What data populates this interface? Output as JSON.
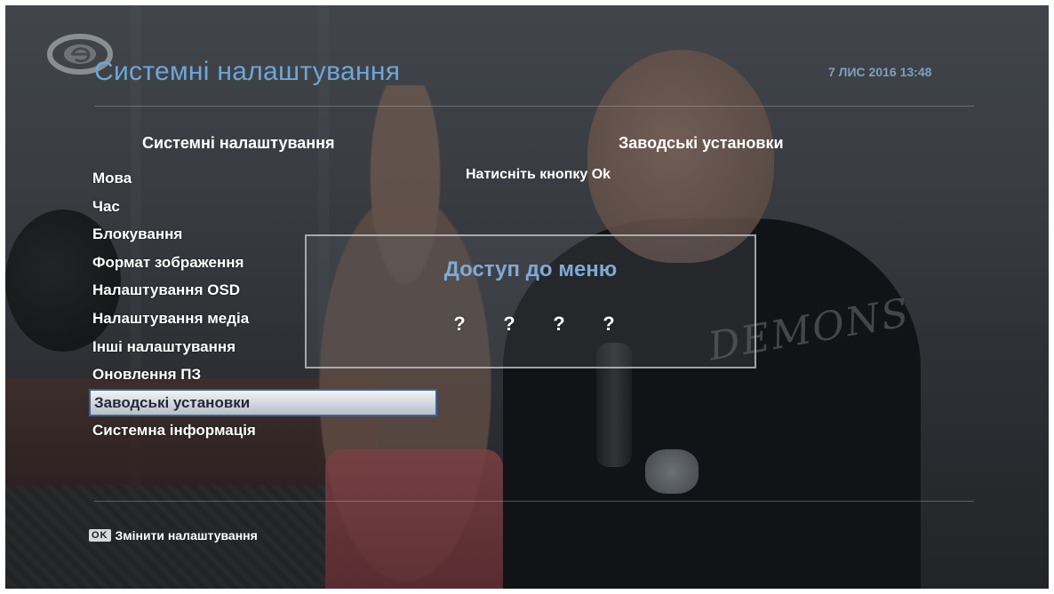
{
  "header": {
    "title": "Системні налаштування",
    "datetime": "7 ЛИС 2016 13:48"
  },
  "left_column": {
    "header": "Системні налаштування",
    "items": [
      {
        "label": "Мова",
        "selected": false
      },
      {
        "label": "Час",
        "selected": false
      },
      {
        "label": "Блокування",
        "selected": false
      },
      {
        "label": "Формат зображення",
        "selected": false
      },
      {
        "label": "Налаштування OSD",
        "selected": false
      },
      {
        "label": "Налаштування медіа",
        "selected": false
      },
      {
        "label": "Інші налаштування",
        "selected": false
      },
      {
        "label": "Оновлення ПЗ",
        "selected": false
      },
      {
        "label": "Заводські установки",
        "selected": true
      },
      {
        "label": "Системна інформація",
        "selected": false
      }
    ]
  },
  "right_column": {
    "header": "Заводські установки",
    "hint": "Натисніть кнопку Ok"
  },
  "dialog": {
    "title": "Доступ до меню",
    "pin": [
      "?",
      "?",
      "?",
      "?"
    ]
  },
  "footer": {
    "key": "OK",
    "label": "Змінити налаштування"
  },
  "background": {
    "shirt_text": "DEMONS"
  },
  "colors": {
    "title": "#6fa6d6",
    "dialog_title": "#7fa9d8",
    "selection_border": "#3a62a0"
  },
  "icons": {
    "logo": "brand-logo-icon"
  }
}
